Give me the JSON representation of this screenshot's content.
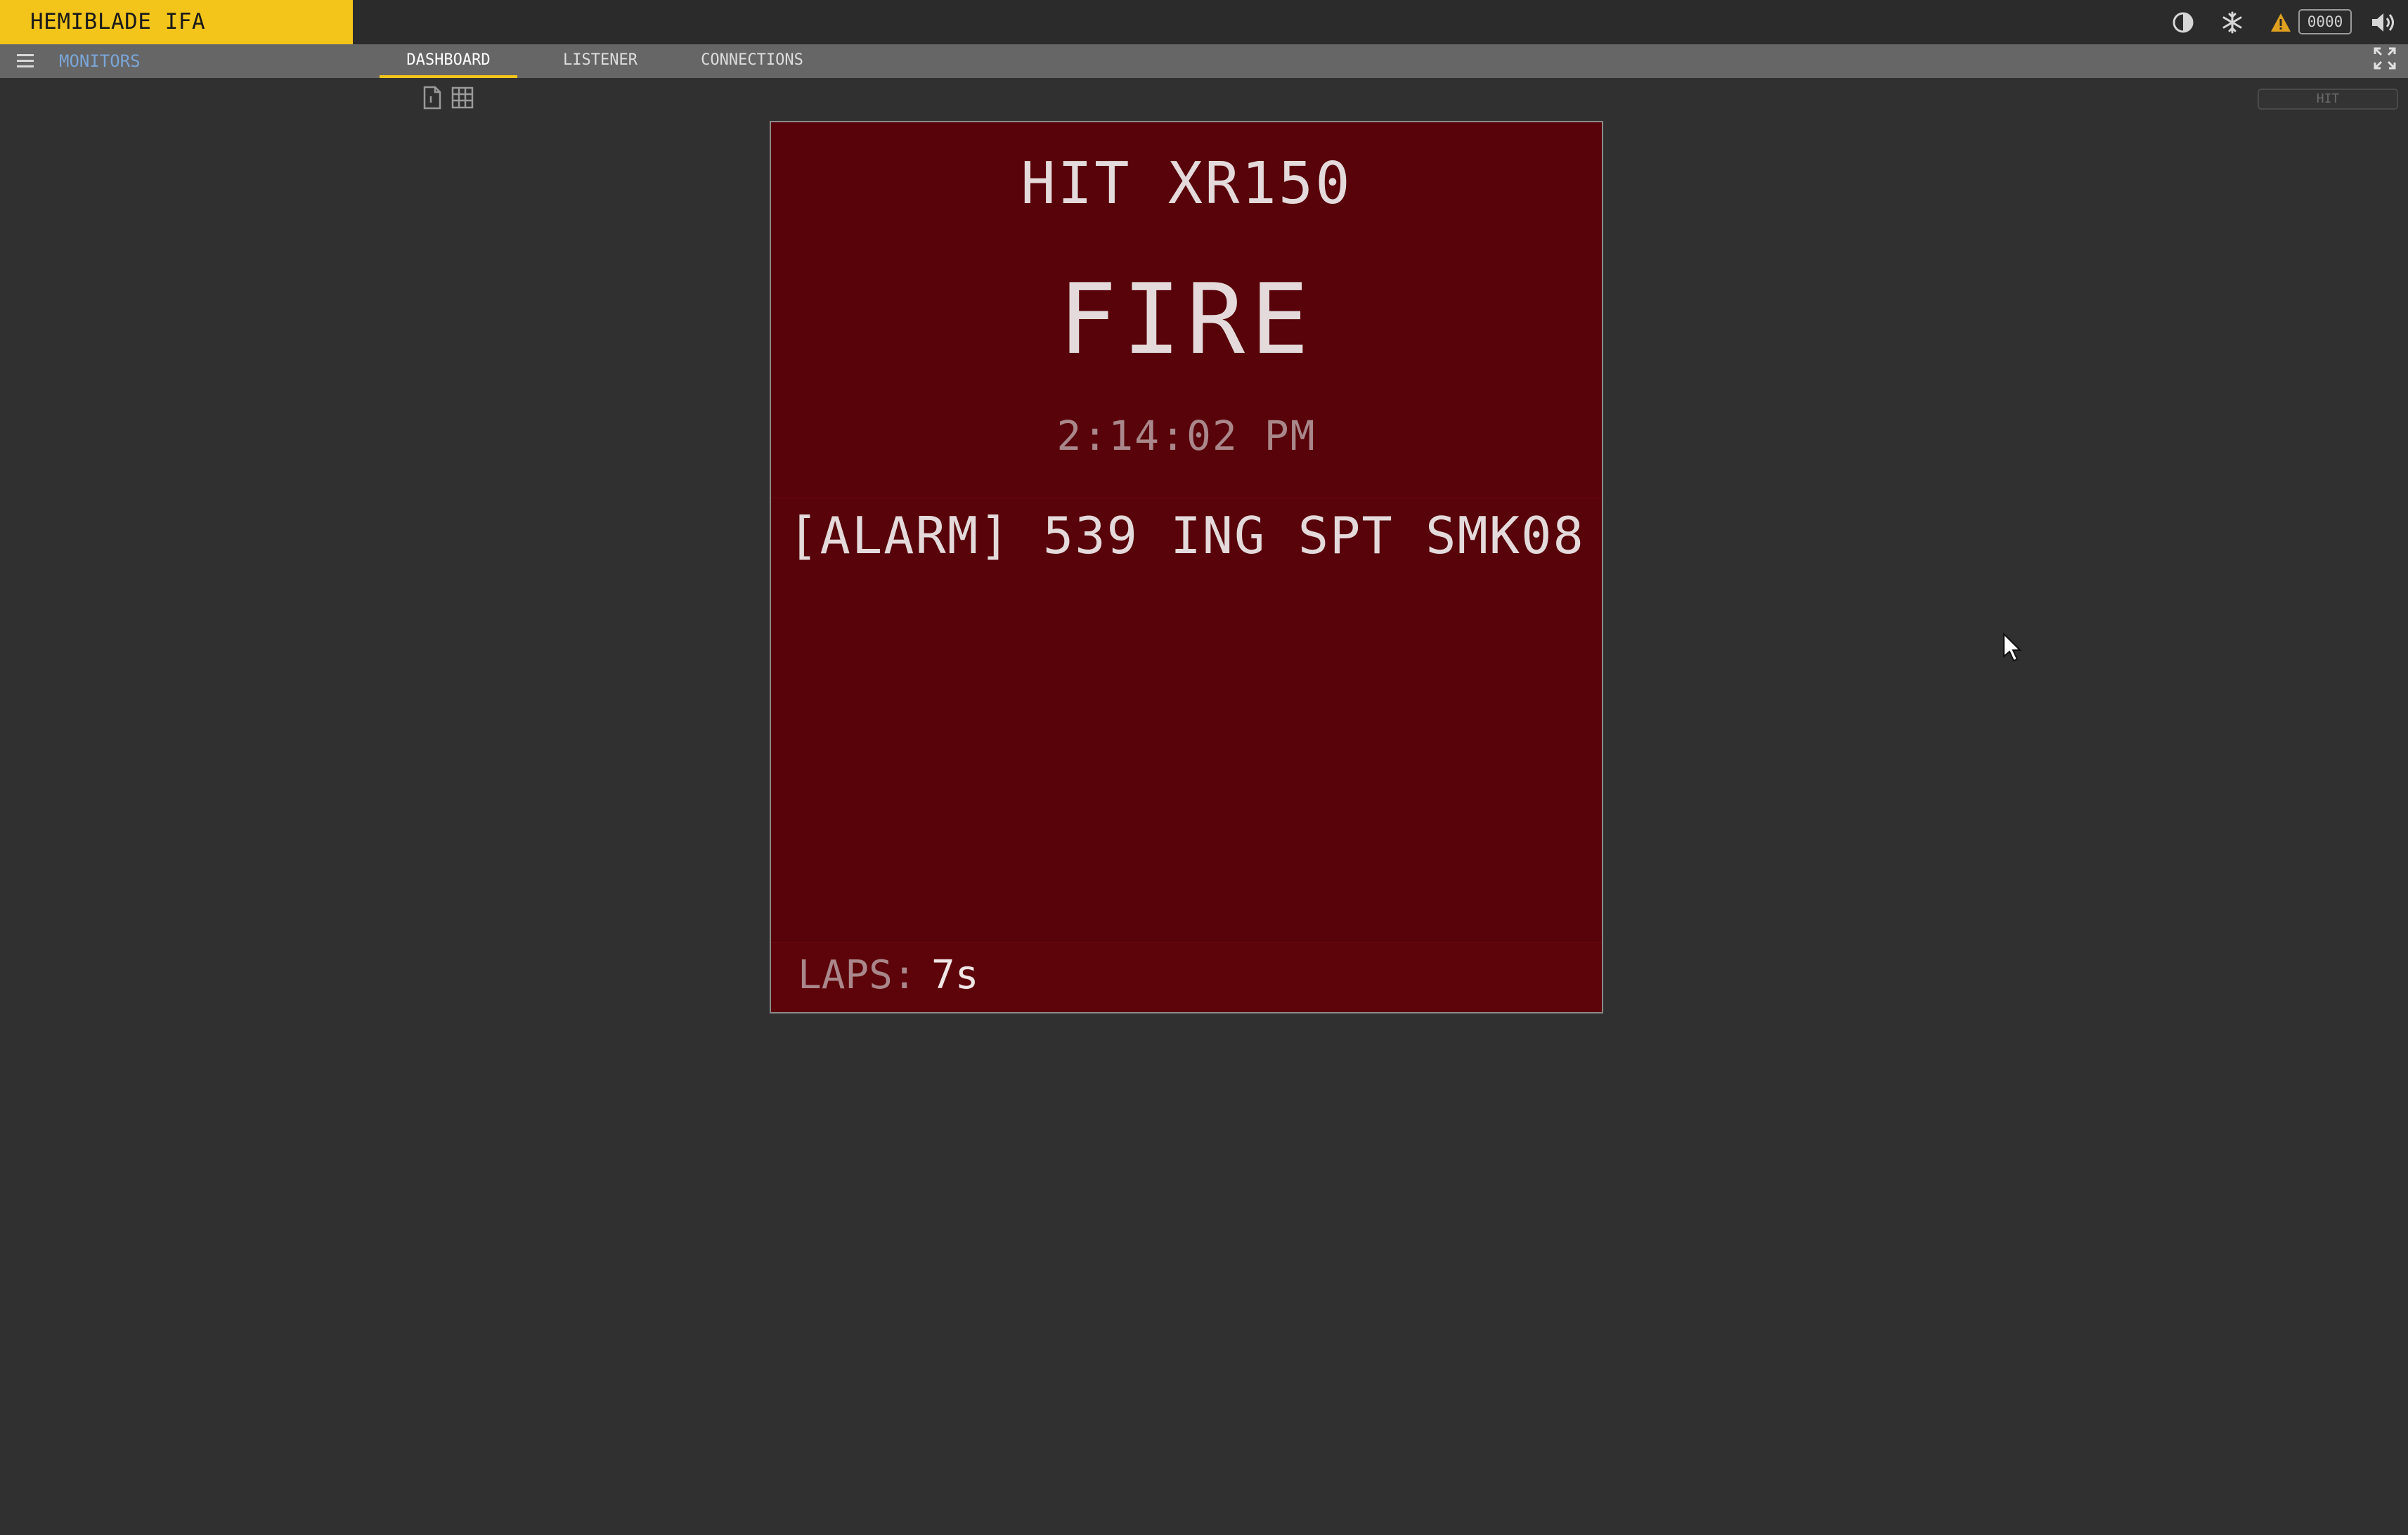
{
  "app": {
    "brand": "HEMIBLADE IFA",
    "counter": "0000"
  },
  "nav": {
    "monitors_label": "MONITORS",
    "tabs": [
      {
        "label": "DASHBOARD",
        "active": true
      },
      {
        "label": "LISTENER",
        "active": false
      },
      {
        "label": "CONNECTIONS",
        "active": false
      }
    ]
  },
  "toolbar": {
    "filter_placeholder": "HIT"
  },
  "alarm_card": {
    "device": "HIT XR150",
    "status": "FIRE",
    "time": "2:14:02 PM",
    "message": "[ALARM] 539 ING SPT SMK08",
    "laps_label": "LAPS:",
    "laps_value": "7s"
  },
  "colors": {
    "brand": "#f3c51b",
    "card_background": "#570309",
    "monitors_link": "#7aa6d8",
    "warning": "#e0a020"
  },
  "icons": {
    "top_right": [
      "contrast-icon",
      "snowflake-icon",
      "warning-icon",
      "speaker-icon"
    ],
    "nav": [
      "hamburger-menu-icon",
      "fullscreen-icon"
    ],
    "view": [
      "single-view-icon",
      "grid-view-icon"
    ]
  }
}
